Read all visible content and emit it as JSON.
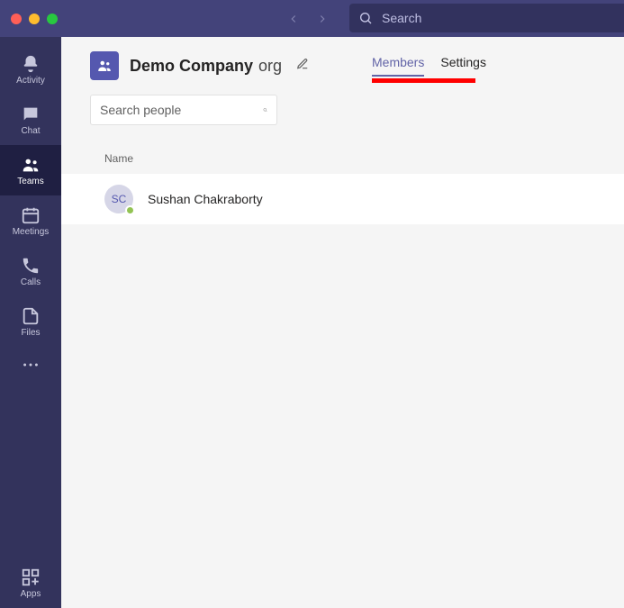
{
  "search": {
    "placeholder": "Search"
  },
  "sidebar": {
    "items": [
      {
        "label": "Activity"
      },
      {
        "label": "Chat"
      },
      {
        "label": "Teams"
      },
      {
        "label": "Meetings"
      },
      {
        "label": "Calls"
      },
      {
        "label": "Files"
      }
    ],
    "apps_label": "Apps"
  },
  "team": {
    "name_bold": "Demo Company",
    "name_light": "org"
  },
  "tabs": {
    "members": "Members",
    "settings": "Settings"
  },
  "people_search": {
    "placeholder": "Search people"
  },
  "table": {
    "name_header": "Name"
  },
  "members": [
    {
      "initials": "SC",
      "name": "Sushan Chakraborty"
    }
  ]
}
